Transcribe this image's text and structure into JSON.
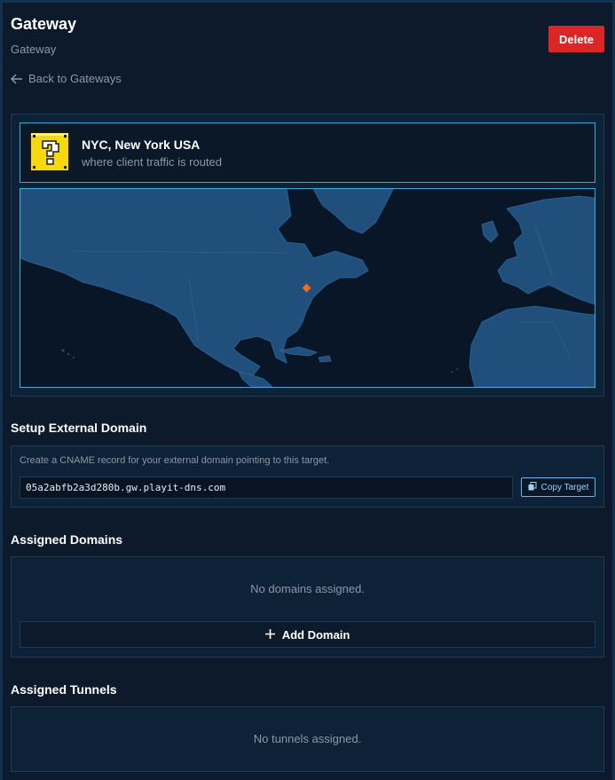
{
  "header": {
    "title": "Gateway",
    "subtitle": "Gateway",
    "back_label": "Back to Gateways",
    "delete_label": "Delete"
  },
  "location": {
    "name": "NYC, New York USA",
    "description": "where client traffic is routed",
    "marker_color": "#f26b1d"
  },
  "external_domain": {
    "section_title": "Setup External Domain",
    "hint": "Create a CNAME record for your external domain pointing to this target.",
    "target": "05a2abfb2a3d280b.gw.playit-dns.com",
    "copy_label": "Copy Target"
  },
  "assigned_domains": {
    "section_title": "Assigned Domains",
    "empty_text": "No domains assigned.",
    "add_label": "Add Domain"
  },
  "assigned_tunnels": {
    "section_title": "Assigned Tunnels",
    "empty_text": "No tunnels assigned."
  },
  "colors": {
    "background": "#0c1a2b",
    "panel": "#0d2137",
    "accent_border": "#3fa7d6",
    "danger": "#dc2626",
    "land": "#1f4f7a"
  }
}
